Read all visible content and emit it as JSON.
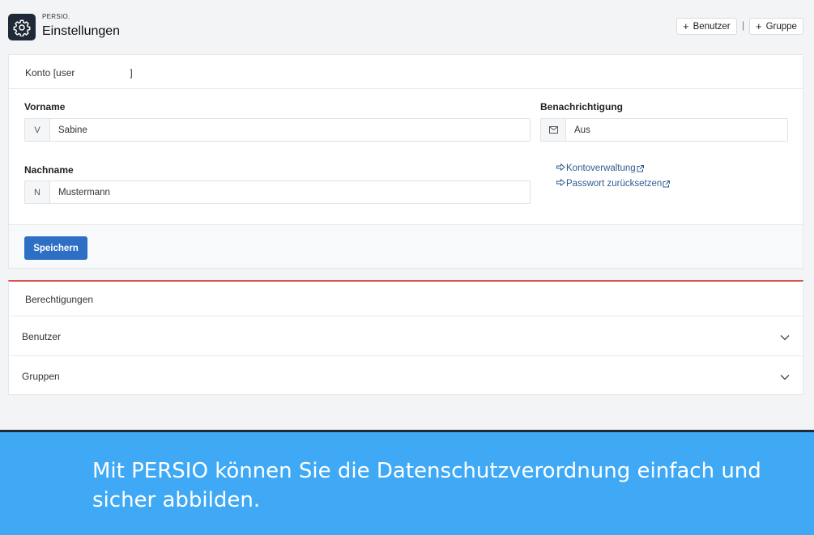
{
  "header": {
    "brand": "PERSIO.",
    "title": "Einstellungen",
    "add_user_label": "Benutzer",
    "add_group_label": "Gruppe",
    "separator": "|"
  },
  "account": {
    "heading": "Konto [user",
    "heading_suffix": "]",
    "first_name_label": "Vorname",
    "first_name_prefix": "V",
    "first_name_value": "Sabine",
    "last_name_label": "Nachname",
    "last_name_prefix": "N",
    "last_name_value": "Mustermann",
    "notification_label": "Benachrichtigung",
    "notification_value": "Aus",
    "links": {
      "account_management": "Kontoverwaltung",
      "reset_password": "Passwort zurücksetzen"
    },
    "save_label": "Speichern"
  },
  "permissions": {
    "heading": "Berechtigungen",
    "sections": [
      "Benutzer",
      "Gruppen"
    ]
  },
  "banner": {
    "text": "Mit PERSIO können Sie die Datenschutzverordnung einfach und sicher abbilden."
  },
  "colors": {
    "primary": "#2d6fc4",
    "banner": "#3fa9f5",
    "accent_line": "#d9534f",
    "link": "#2e5c8f"
  },
  "icons": {
    "app": "gear-icon",
    "notification": "envelope-icon",
    "link_arrow": "arrow-right-icon",
    "external": "external-link-icon",
    "accordion": "chevron-down-icon"
  }
}
